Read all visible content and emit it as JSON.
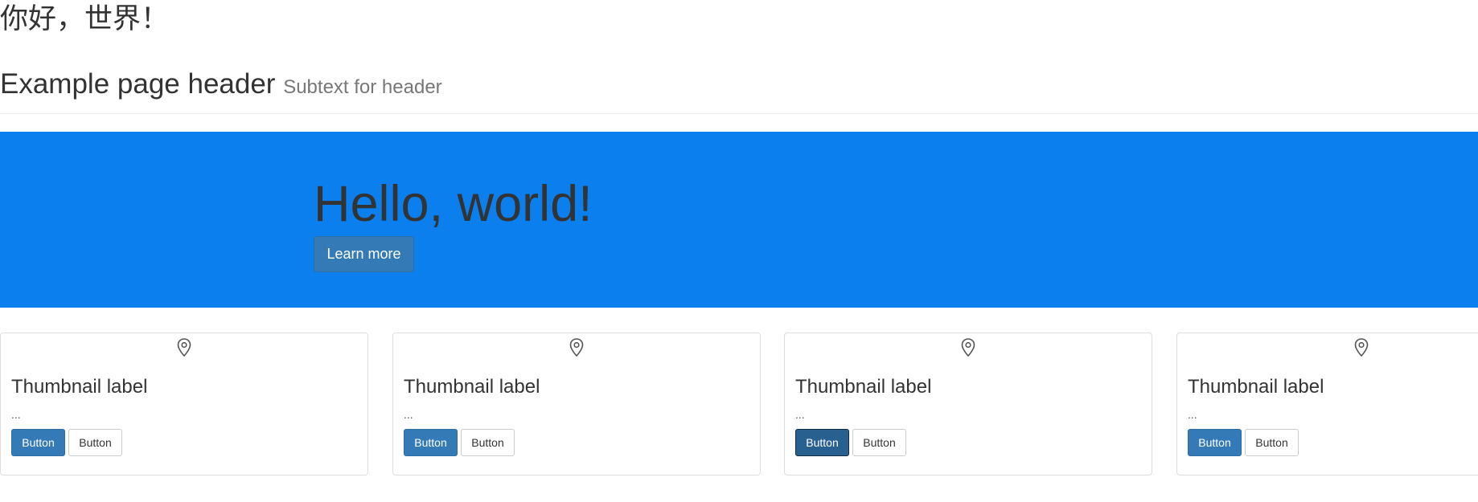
{
  "title_zh": "你好，世界！",
  "header": {
    "title": "Example page header",
    "subtext": "Subtext for header"
  },
  "jumbotron": {
    "heading": "Hello, world!",
    "button_label": "Learn more"
  },
  "thumbnails": [
    {
      "label": "Thumbnail label",
      "description": "...",
      "primary_button": "Button",
      "default_button": "Button",
      "icon": "map-pin-icon"
    },
    {
      "label": "Thumbnail label",
      "description": "...",
      "primary_button": "Button",
      "default_button": "Button",
      "icon": "map-pin-icon"
    },
    {
      "label": "Thumbnail label",
      "description": "...",
      "primary_button": "Button",
      "default_button": "Button",
      "icon": "map-pin-icon",
      "primary_active": true
    },
    {
      "label": "Thumbnail label",
      "description": "...",
      "primary_button": "Button",
      "default_button": "Button",
      "icon": "map-pin-icon"
    }
  ],
  "colors": {
    "jumbotron_bg": "#0a7fed",
    "primary": "#337ab7",
    "primary_active": "#286090",
    "border": "#dddddd"
  }
}
